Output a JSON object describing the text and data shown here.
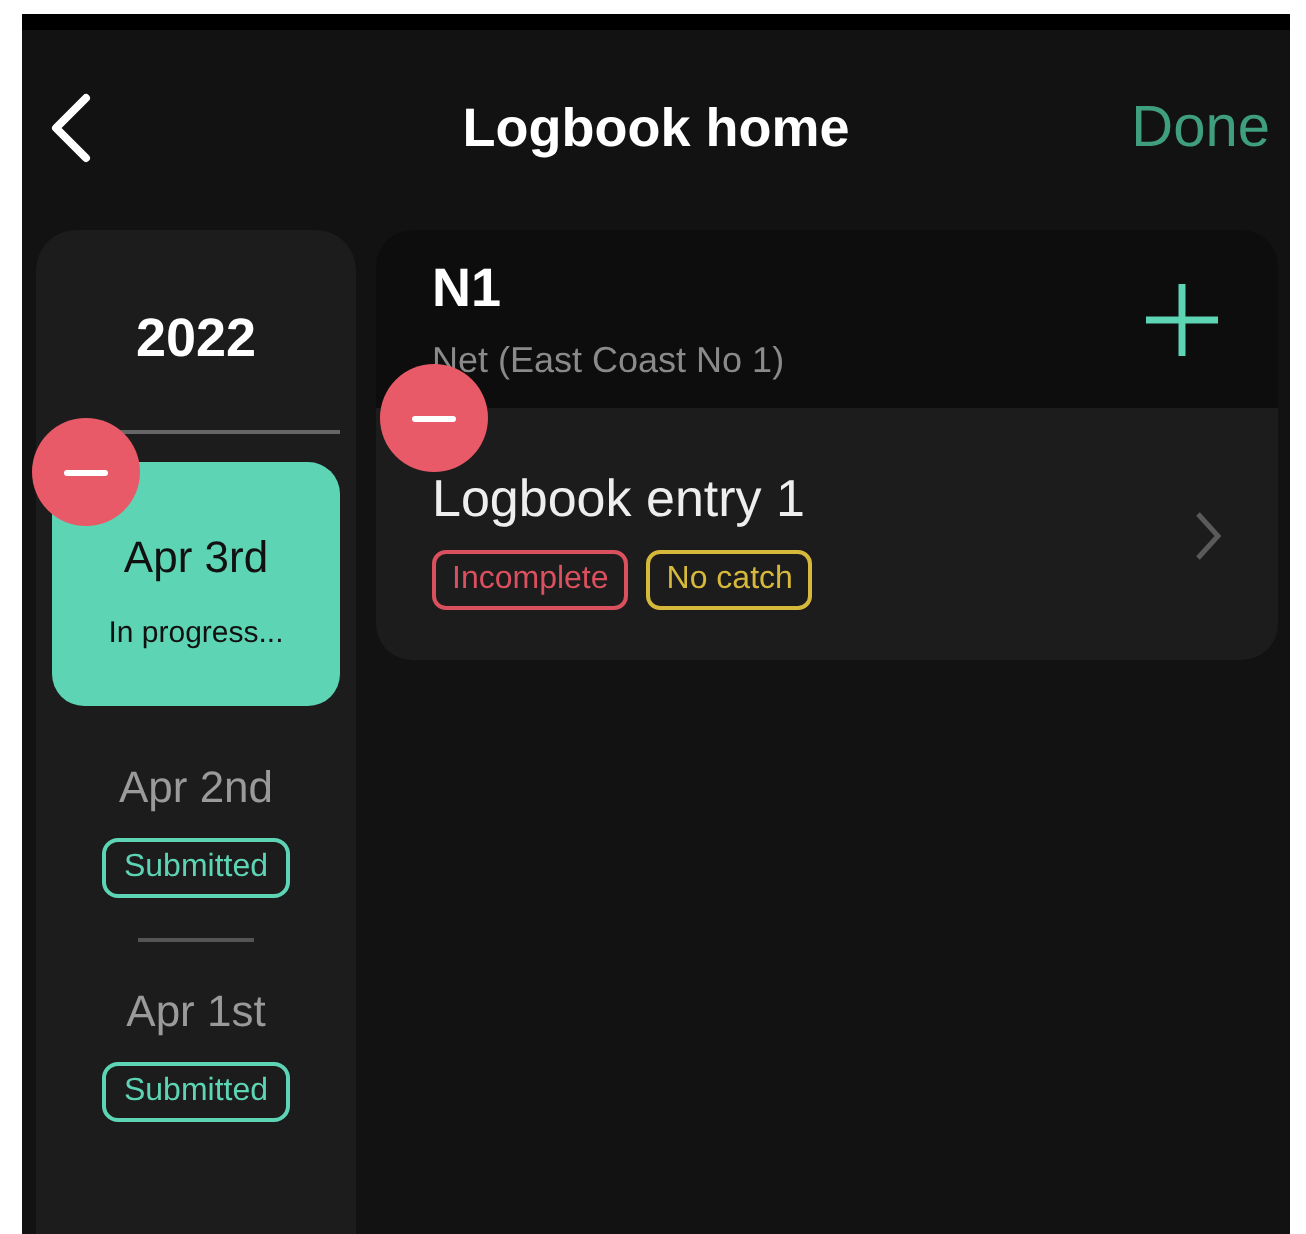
{
  "header": {
    "title": "Logbook home",
    "action": "Done"
  },
  "sidebar": {
    "year": "2022",
    "days": [
      {
        "date": "Apr 3rd",
        "status": "In progress...",
        "selected": true,
        "removable": true
      },
      {
        "date": "Apr 2nd",
        "status": "Submitted",
        "selected": false,
        "removable": false
      },
      {
        "date": "Apr 1st",
        "status": "Submitted",
        "selected": false,
        "removable": false
      }
    ]
  },
  "gear": {
    "code": "N1",
    "description": "Net (East Coast No 1)",
    "entries": [
      {
        "title": "Logbook entry 1",
        "removable": true,
        "tags": [
          {
            "label": "Incomplete",
            "color": "#d9505e"
          },
          {
            "label": "No catch",
            "color": "#d6b93a"
          }
        ]
      }
    ]
  }
}
